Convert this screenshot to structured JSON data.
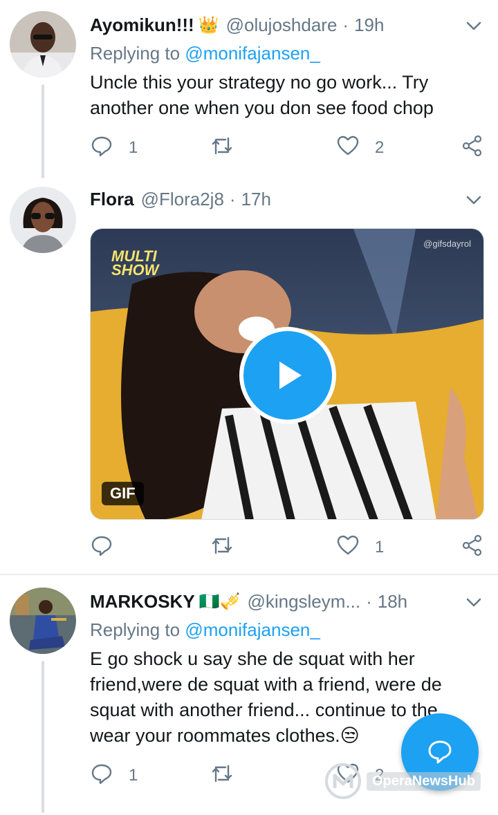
{
  "tweets": [
    {
      "name": "Ayomikun!!!",
      "badge": "👑",
      "handle": "@olujoshdare",
      "time": "19h",
      "replying_prefix": "Replying to",
      "replying_to": "@monifajansen_",
      "text": "Uncle this your strategy no go work... Try another one when you don see food chop",
      "reply_count": "1",
      "retweet_count": "",
      "like_count": "2"
    },
    {
      "name": "Flora",
      "handle": "@Flora2j8",
      "time": "17h",
      "media": {
        "type_label": "GIF",
        "overlay_logo": "MULTI\nSHOW",
        "credit": "@gifsdayrol"
      },
      "reply_count": "",
      "retweet_count": "",
      "like_count": "1"
    },
    {
      "name": "MARKOSKY",
      "badge": "🇳🇬🎺",
      "handle": "@kingsleym...",
      "time": "18h",
      "replying_prefix": "Replying to",
      "replying_to": "@monifajansen_",
      "text": "E go shock u say she de squat with her friend,were de squat with a friend, were de squat with another friend... continue to the wear your roommates clothes.😒",
      "reply_count": "1",
      "retweet_count": "",
      "like_count": "2"
    }
  ],
  "watermark": "OperaNewsHub",
  "colors": {
    "accent": "#1da1f2",
    "muted": "#657786",
    "text": "#14171a"
  },
  "icons": [
    "reply-icon",
    "retweet-icon",
    "like-icon",
    "share-icon",
    "caret-down-icon",
    "play-icon",
    "compose-icon"
  ]
}
